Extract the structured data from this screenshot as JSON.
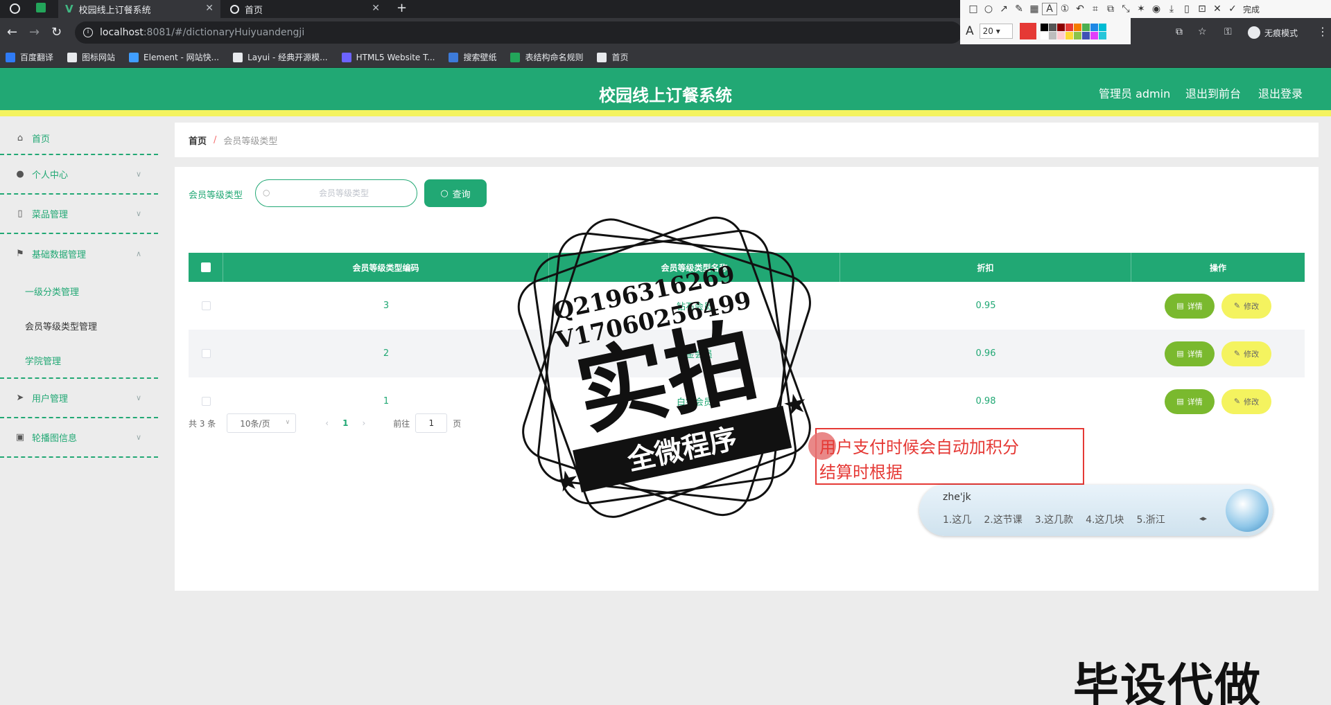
{
  "browser": {
    "tabs": [
      {
        "title": "校园线上订餐系统"
      },
      {
        "title": "首页"
      }
    ],
    "url_host": "localhost",
    "url_path": ":8081/#/dictionaryHuiyuandengji",
    "incognito_label": "无痕模式",
    "bookmarks": [
      {
        "label": "百度翻译",
        "color": "#2f7bf5"
      },
      {
        "label": "图标网站",
        "color": "#e8eaed"
      },
      {
        "label": "Element - 网站快...",
        "color": "#409eff"
      },
      {
        "label": "Layui - 经典开源模...",
        "color": "#e8eaed"
      },
      {
        "label": "HTML5 Website T...",
        "color": "#6c63ff"
      },
      {
        "label": "搜索壁纸",
        "color": "#3d7bd9"
      },
      {
        "label": "表结构命名规则",
        "color": "#23a55a"
      },
      {
        "label": "首页",
        "color": "#e8eaed"
      }
    ]
  },
  "annotation_toolbar": {
    "done_label": "完成",
    "font_size": "20",
    "current_color": "#e53935",
    "palette": [
      "#000000",
      "#555555",
      "#8b0000",
      "#e53935",
      "#f57c00",
      "#4caf50",
      "#1e88e5",
      "#00bcd4",
      "#ffffff",
      "#bdbdbd",
      "#ffcdd2",
      "#fdd835",
      "#8bc34a",
      "#3f51b5",
      "#e040fb",
      "#26c6da"
    ]
  },
  "app": {
    "title": "校园线上订餐系统",
    "header_links": {
      "admin": "管理员 admin",
      "front": "退出到前台",
      "logout": "退出登录"
    },
    "accent": "#21a874",
    "highlight": "#f4f35f"
  },
  "sidebar": {
    "home": "首页",
    "personal": "个人中心",
    "dishes": "菜品管理",
    "basic": "基础数据管理",
    "basic_sub": [
      "一级分类管理",
      "会员等级类型管理",
      "学院管理"
    ],
    "users": "用户管理",
    "carousel": "轮播图信息"
  },
  "breadcrumb": {
    "home": "首页",
    "sep": "/",
    "current": "会员等级类型"
  },
  "search": {
    "label": "会员等级类型",
    "placeholder": "会员等级类型",
    "button": "查询"
  },
  "table": {
    "columns": [
      "会员等级类型编码",
      "会员等级类型名称",
      "折扣",
      "操作"
    ],
    "rows": [
      {
        "code": "3",
        "name": "钻石会员",
        "discount": "0.95"
      },
      {
        "code": "2",
        "name": "黄金会员",
        "discount": "0.96"
      },
      {
        "code": "1",
        "name": "白银会员",
        "discount": "0.98"
      }
    ],
    "detail_label": "详情",
    "edit_label": "修改"
  },
  "pagination": {
    "total": "共 3 条",
    "page_size": "10条/页",
    "current": "1",
    "goto_label": "前往",
    "goto_value": "1",
    "page_suffix": "页"
  },
  "overlays": {
    "stamp_line1": "Q2196316269",
    "stamp_line2": "V17060256499",
    "stamp_main": "实拍",
    "stamp_banner": "全微程序",
    "note": "用户支付时候会自动加积分\n结算时根据",
    "ime_input": "zhe'jk",
    "ime_candidates": [
      "1.这几",
      "2.这节课",
      "3.这几款",
      "4.这几块",
      "5.浙江"
    ],
    "watermark": "毕设代做"
  }
}
